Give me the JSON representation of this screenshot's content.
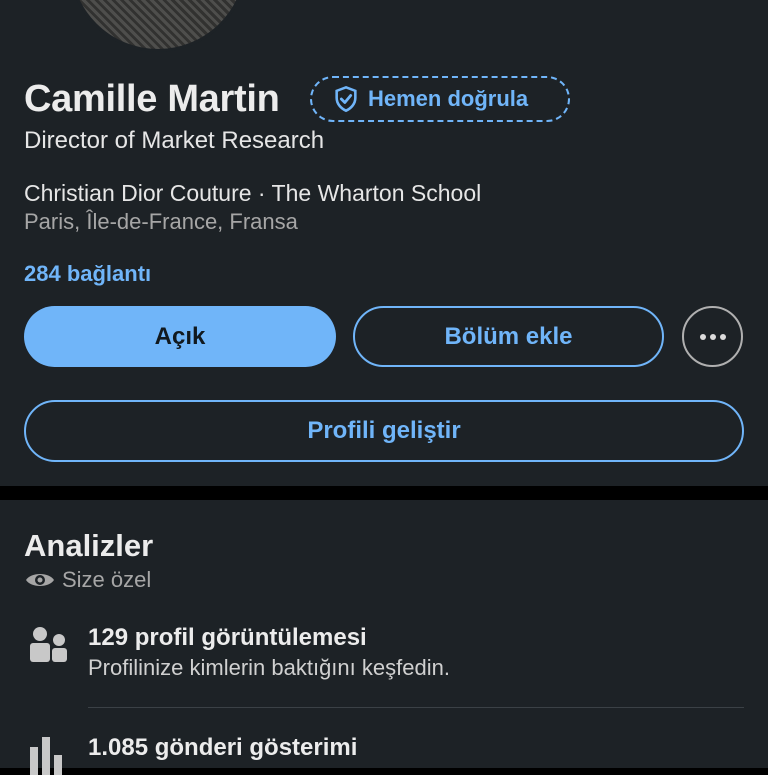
{
  "profile": {
    "name": "Camille Martin",
    "verify_label": "Hemen doğrula",
    "headline": "Director of Market Research",
    "organizations": "Christian Dior Couture · The Wharton School",
    "location": "Paris, Île-de-France, Fransa",
    "connections": "284 bağlantı"
  },
  "actions": {
    "primary_label": "Açık",
    "add_section_label": "Bölüm ekle",
    "more_icon": "more-horizontal-icon",
    "enhance_label": "Profili geliştir"
  },
  "analytics": {
    "title": "Analizler",
    "visibility": "Size özel",
    "items": [
      {
        "icon": "people-icon",
        "title": "129 profil görüntülemesi",
        "subtitle": "Profilinize kimlerin baktığını keşfedin."
      },
      {
        "icon": "bar-chart-icon",
        "title": "1.085 gönderi gösterimi"
      }
    ]
  },
  "colors": {
    "background": "#1d2226",
    "accent": "#70b5f9",
    "separator": "#000000"
  }
}
